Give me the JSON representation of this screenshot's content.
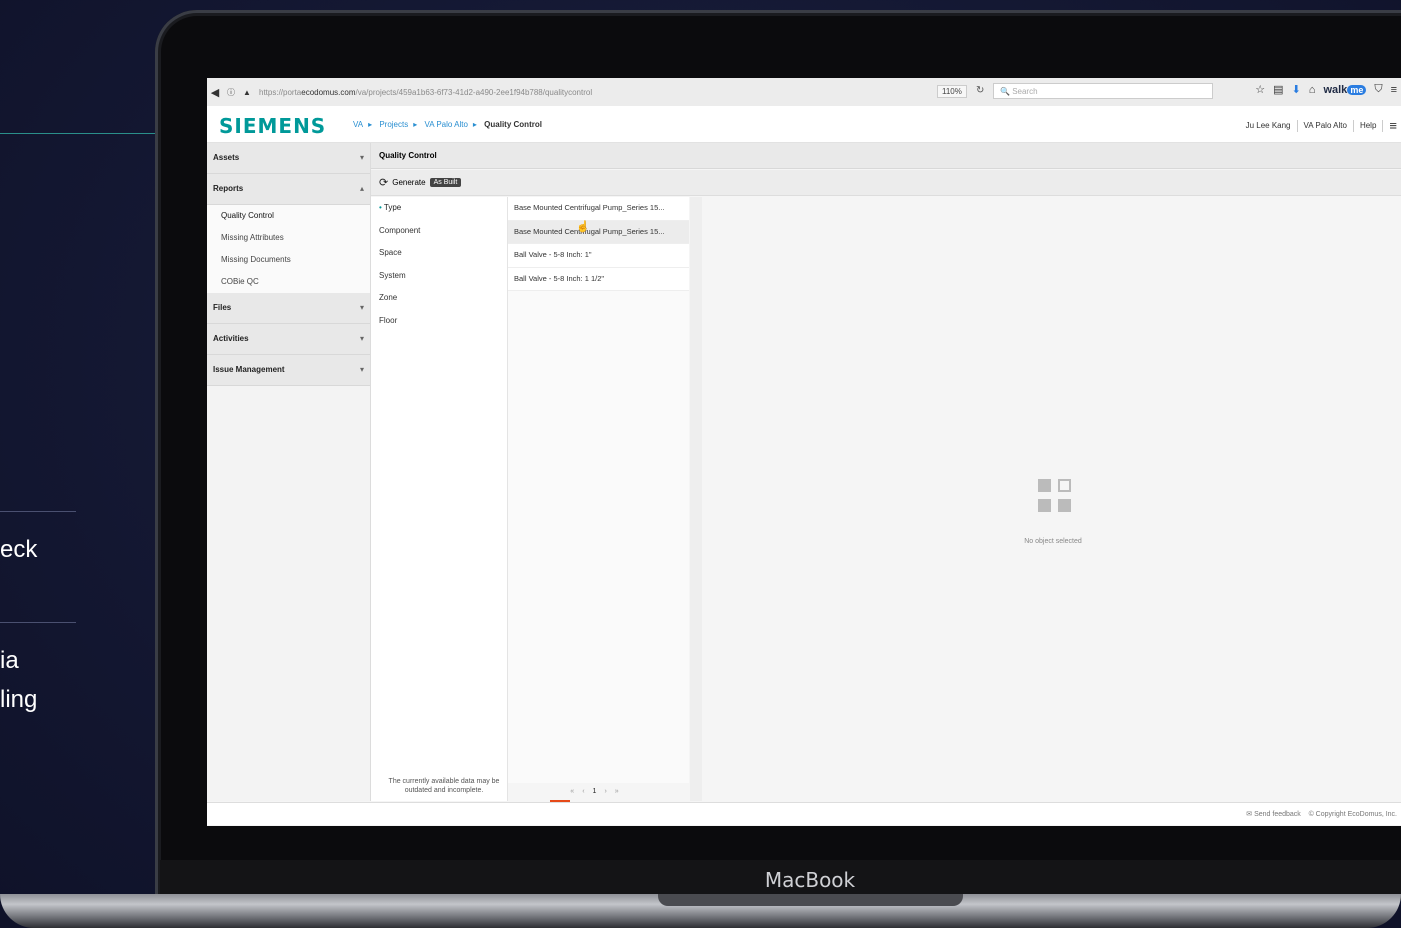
{
  "slide": {
    "text1": "eck",
    "text2_line1": "ia",
    "text2_line2": "ling"
  },
  "laptop": {
    "brand_label": "MacBook"
  },
  "browser": {
    "url_prefix": "https://porta",
    "url_host": "ecodomus.com",
    "url_path": "/va/projects/459a1b63-6f73-41d2-a490-2ee1f94b788/qualitycontrol",
    "zoom": "110%",
    "search_placeholder": "Search",
    "walkme_label": "walk",
    "walkme_badge": "me"
  },
  "app": {
    "logo": "SIEMENS",
    "breadcrumb": [
      "VA",
      "Projects",
      "VA Palo Alto",
      "Quality Control"
    ],
    "user_name": "Ju Lee Kang",
    "site_name": "VA Palo Alto",
    "help": "Help"
  },
  "sidebar": {
    "sections": [
      {
        "label": "Assets",
        "chevron": "▾"
      },
      {
        "label": "Reports",
        "chevron": "▴"
      },
      {
        "label": "Files",
        "chevron": "▾"
      },
      {
        "label": "Activities",
        "chevron": "▾"
      },
      {
        "label": "Issue Management",
        "chevron": "▾"
      }
    ],
    "report_items": [
      "Quality Control",
      "Missing Attributes",
      "Missing Documents",
      "COBie QC"
    ]
  },
  "main": {
    "title": "Quality Control",
    "generate_label": "Generate",
    "badge": "As Built",
    "types": [
      "Type",
      "Component",
      "Space",
      "System",
      "Zone",
      "Floor"
    ],
    "items": [
      "Base Mounted Centrifugal Pump_Series 15...",
      "Base Mounted Centrifugal Pump_Series 15...",
      "Ball Valve - 5-8 Inch: 1\"",
      "Ball Valve - 5-8 Inch: 1 1/2\""
    ],
    "disclaimer": "The currently available data may be outdated and incomplete.",
    "pager": {
      "prev_first": "«",
      "prev": "‹",
      "current": "1",
      "next": "›",
      "next_last": "»"
    },
    "empty_text": "No object selected"
  },
  "footer": {
    "feedback": "Send feedback",
    "copyright": "© Copyright EcoDomus, Inc."
  }
}
